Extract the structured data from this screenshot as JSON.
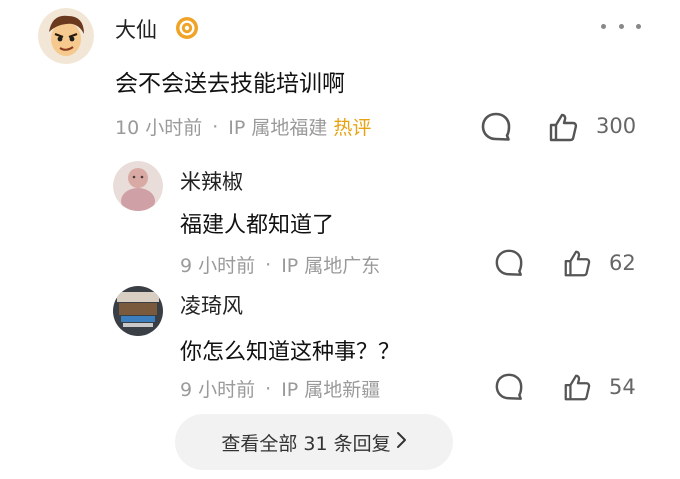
{
  "comment": {
    "author": "大仙",
    "text": "会不会送去技能培训啊",
    "time": "10 小时前",
    "location": "IP 属地福建",
    "tag": "热评",
    "likes": "300"
  },
  "replies": [
    {
      "author": "米辣椒",
      "text": "福建人都知道了",
      "time": "9 小时前",
      "location": "IP 属地广东",
      "likes": "62"
    },
    {
      "author": "凌琦风",
      "text": "你怎么知道这种事？？",
      "time": "9 小时前",
      "location": "IP 属地新疆",
      "likes": "54"
    }
  ],
  "view_replies": "查看全部 31 条回复",
  "separator": "·",
  "icons": {
    "verified": "verified-badge-icon",
    "comment": "comment-bubble-icon",
    "like": "thumbs-up-icon",
    "more": "more-dots-icon",
    "chevron": "chevron-right-icon"
  },
  "colors": {
    "hot_tag": "#e8a312",
    "meta": "#9a9a9a",
    "badge": "#f0a326"
  }
}
